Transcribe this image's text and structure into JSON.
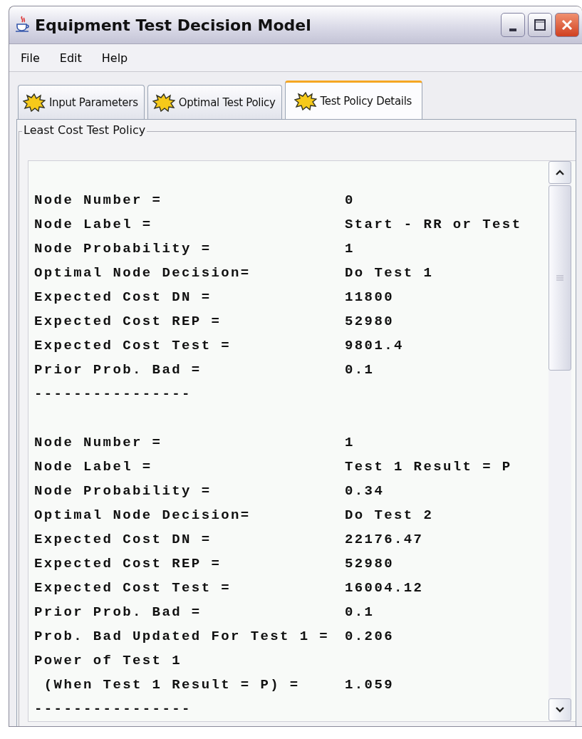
{
  "window": {
    "title": "Equipment Test Decision Model"
  },
  "menu": [
    "File",
    "Edit",
    "Help"
  ],
  "tabs": [
    {
      "label": "Input Parameters",
      "selected": false
    },
    {
      "label": "Optimal Test Policy",
      "selected": false
    },
    {
      "label": "Test Policy Details",
      "selected": true
    }
  ],
  "panel": {
    "title": "Least Cost Test Policy",
    "lines": [
      {
        "kind": "blank"
      },
      {
        "kind": "field",
        "label": "Node Number =",
        "value": "0"
      },
      {
        "kind": "field",
        "label": "Node Label =",
        "value": "Start - RR or Test"
      },
      {
        "kind": "field",
        "label": "Node Probability =",
        "value": "1"
      },
      {
        "kind": "field",
        "label": "Optimal Node Decision=",
        "value": "Do Test 1"
      },
      {
        "kind": "field",
        "label": "Expected Cost DN =",
        "value": "11800"
      },
      {
        "kind": "field",
        "label": "Expected Cost REP =",
        "value": "52980"
      },
      {
        "kind": "field",
        "label": "Expected Cost Test =",
        "value": "9801.4"
      },
      {
        "kind": "field",
        "label": "Prior Prob. Bad =",
        "value": "0.1"
      },
      {
        "kind": "rule",
        "label": "----------------"
      },
      {
        "kind": "blank"
      },
      {
        "kind": "field",
        "label": "Node Number =",
        "value": "1"
      },
      {
        "kind": "field",
        "label": "Node Label =",
        "value": "Test 1 Result = P"
      },
      {
        "kind": "field",
        "label": "Node Probability =",
        "value": "0.34"
      },
      {
        "kind": "field",
        "label": "Optimal Node Decision=",
        "value": "Do Test 2"
      },
      {
        "kind": "field",
        "label": "Expected Cost DN =",
        "value": "22176.47"
      },
      {
        "kind": "field",
        "label": "Expected Cost REP =",
        "value": "52980"
      },
      {
        "kind": "field",
        "label": "Expected Cost Test =",
        "value": "16004.12"
      },
      {
        "kind": "field",
        "label": "Prior Prob. Bad =",
        "value": "0.1"
      },
      {
        "kind": "field",
        "label": "Prob. Bad Updated For Test 1 =",
        "value": "0.206"
      },
      {
        "kind": "field",
        "label": "Power of Test 1"
      },
      {
        "kind": "field",
        "label": " (When Test 1 Result = P) =",
        "value": "1.059"
      },
      {
        "kind": "rule",
        "label": "----------------"
      }
    ]
  }
}
